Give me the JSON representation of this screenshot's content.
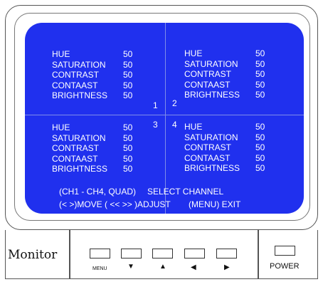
{
  "osd": {
    "quads": [
      {
        "items": [
          {
            "label": "HUE",
            "value": "50"
          },
          {
            "label": "SATURATION",
            "value": "50"
          },
          {
            "label": "CONTRAST",
            "value": "50"
          },
          {
            "label": "CONTAAST",
            "value": "50"
          },
          {
            "label": "BRIGHTNESS",
            "value": "50"
          }
        ]
      },
      {
        "items": [
          {
            "label": "HUE",
            "value": "50"
          },
          {
            "label": "SATURATION",
            "value": "50"
          },
          {
            "label": "CONTRAST",
            "value": "50"
          },
          {
            "label": "CONTAAST",
            "value": "50"
          },
          {
            "label": "BRIGHTNESS",
            "value": "50"
          }
        ]
      },
      {
        "items": [
          {
            "label": "HUE",
            "value": "50"
          },
          {
            "label": "SATURATION",
            "value": "50"
          },
          {
            "label": "CONTRAST",
            "value": "50"
          },
          {
            "label": "CONTAAST",
            "value": "50"
          },
          {
            "label": "BRIGHTNESS",
            "value": "50"
          }
        ]
      },
      {
        "items": [
          {
            "label": "HUE",
            "value": "50"
          },
          {
            "label": "SATURATION",
            "value": "50"
          },
          {
            "label": "CONTRAST",
            "value": "50"
          },
          {
            "label": "CONTAAST",
            "value": "50"
          },
          {
            "label": "BRIGHTNESS",
            "value": "50"
          }
        ]
      }
    ],
    "channels": [
      "1",
      "2",
      "3",
      "4"
    ],
    "help_line1_left": "(CH1 - CH4, QUAD)",
    "help_line1_right": "SELECT CHANNEL",
    "help_line2_left": "(< >)MOVE ( <<  >> )ADJUST",
    "help_line2_right": "(MENU) EXIT"
  },
  "panel": {
    "brand": "Monitor",
    "menu_label": "MENU",
    "power_label": "POWER",
    "icons": {
      "down": "triangle-down-icon",
      "up": "triangle-up-icon",
      "left": "triangle-left-icon",
      "right": "triangle-right-icon"
    }
  },
  "colors": {
    "screen": "#2030ee",
    "divider": "#7f8ce8",
    "text": "#ffffff"
  }
}
